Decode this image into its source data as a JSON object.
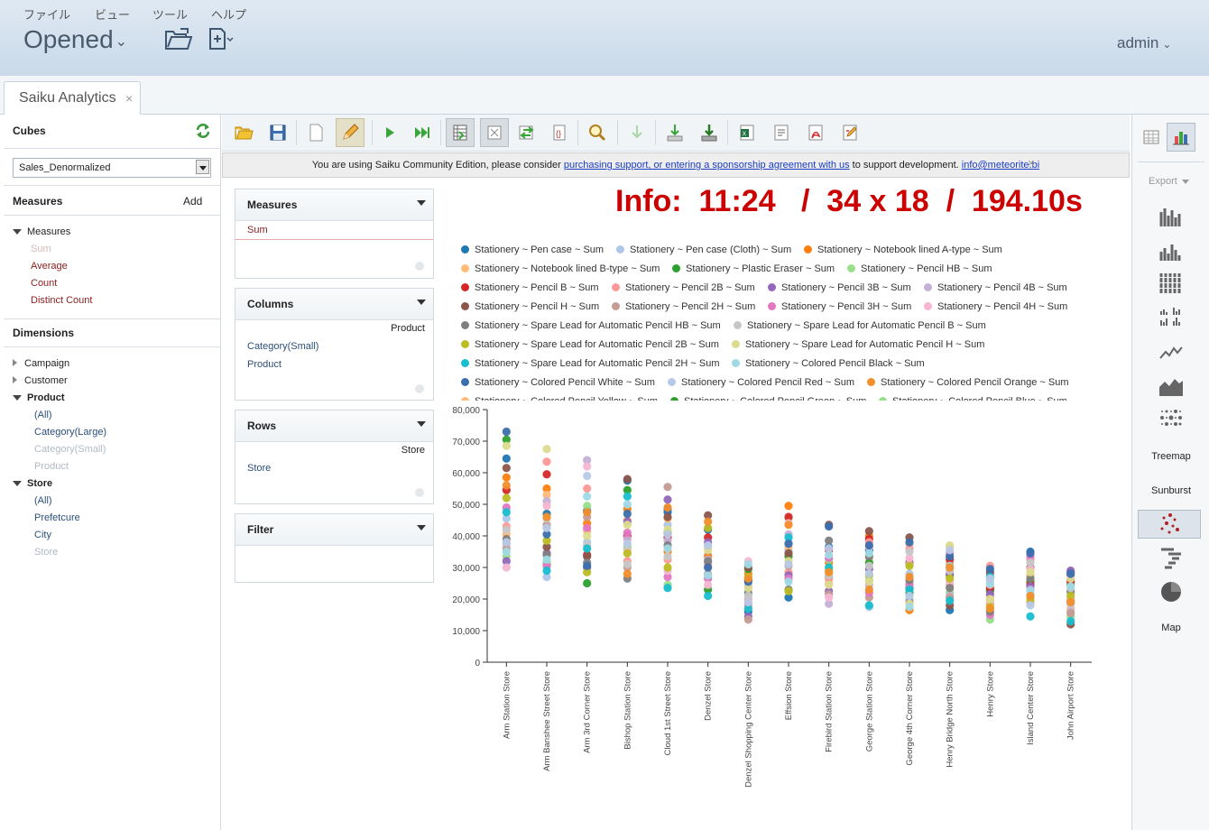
{
  "menu": {
    "file": "ファイル",
    "view": "ビュー",
    "tools": "ツール",
    "help": "ヘルプ"
  },
  "header": {
    "title": "Opened",
    "user": "admin"
  },
  "tab": {
    "label": "Saiku Analytics",
    "close": "×"
  },
  "left": {
    "cubes_label": "Cubes",
    "cube_select": "Sales_Denormalized",
    "measures_label": "Measures",
    "add_label": "Add",
    "measures_root": "Measures",
    "measures": [
      {
        "label": "Sum",
        "disabled": true
      },
      {
        "label": "Average",
        "disabled": false
      },
      {
        "label": "Count",
        "disabled": false
      },
      {
        "label": "Distinct Count",
        "disabled": false
      }
    ],
    "dimensions_label": "Dimensions",
    "dimensions": [
      {
        "label": "Campaign",
        "expanded": false
      },
      {
        "label": "Customer",
        "expanded": false
      },
      {
        "label": "Product",
        "expanded": true,
        "levels": [
          {
            "label": "(All)",
            "disabled": false
          },
          {
            "label": "Category(Large)",
            "disabled": false
          },
          {
            "label": "Category(Small)",
            "disabled": true
          },
          {
            "label": "Product",
            "disabled": true
          }
        ]
      },
      {
        "label": "Store",
        "expanded": true,
        "levels": [
          {
            "label": "(All)",
            "disabled": false
          },
          {
            "label": "Prefetcure",
            "disabled": false
          },
          {
            "label": "City",
            "disabled": false
          },
          {
            "label": "Store",
            "disabled": true
          }
        ]
      }
    ]
  },
  "notice": {
    "before": "You are using Saiku Community Edition, please consider ",
    "link": "purchasing support, or entering a sponsorship agreement with us",
    "after": " to support development. ",
    "email": "info@meteorite.bi",
    "close": "×"
  },
  "workspace": {
    "measures": {
      "label": "Measures",
      "item": "Sum"
    },
    "columns": {
      "label": "Columns",
      "header": "Product",
      "items": [
        "Category(Small)",
        "Product"
      ]
    },
    "rows": {
      "label": "Rows",
      "header": "Store",
      "items": [
        "Store"
      ]
    },
    "filter": {
      "label": "Filter"
    }
  },
  "info": "Info:  11:24   /  34 x 18  /  194.10s",
  "right": {
    "export": "Export",
    "treemap": "Treemap",
    "sunburst": "Sunburst",
    "map": "Map"
  },
  "chart_data": {
    "type": "scatter",
    "ylim": [
      0,
      80000
    ],
    "yticks": [
      "0",
      "10,000",
      "20,000",
      "30,000",
      "40,000",
      "50,000",
      "60,000",
      "70,000",
      "80,000"
    ],
    "categories": [
      "Arm Station Store",
      "Arm Banshee Street Store",
      "Arm 3rd Corner Store",
      "Bishop Station Store",
      "Cloud 1st Street Store",
      "Denzel Store",
      "Denzel Shopping Center Store",
      "Effsion Store",
      "Firebird Station Store",
      "George Station Store",
      "George 4th Corner Store",
      "Henry Bridge North Store",
      "Henry Store",
      "Island Center Store",
      "John Airport Store"
    ],
    "series": [
      {
        "name": "Stationery ~ Pen case ~ Sum",
        "color": "#1f77b4",
        "values": [
          64500,
          47000,
          48000,
          57500,
          47500,
          42000,
          16000,
          20500,
          36500,
          35500,
          23500,
          16500,
          23000,
          35000,
          28500
        ]
      },
      {
        "name": "Stationery ~ Pen case (Cloth) ~ Sum",
        "color": "#aec7e8",
        "values": [
          45500,
          27000,
          38000,
          36000,
          43500,
          34000,
          25000,
          35500,
          22000,
          17500,
          28000,
          30000,
          26000,
          21500,
          22000
        ]
      },
      {
        "name": "Stationery ~ Notebook lined A-type ~ Sum",
        "color": "#ff7f0e",
        "values": [
          58500,
          55000,
          44000,
          48500,
          35000,
          33500,
          28000,
          49500,
          31500,
          40000,
          16500,
          31000,
          18500,
          25500,
          19500
        ]
      },
      {
        "name": "Stationery ~ Notebook lined B-type ~ Sum",
        "color": "#ffbb78",
        "values": [
          40500,
          53000,
          41500,
          45000,
          45500,
          31500,
          17500,
          36500,
          25000,
          33000,
          37500,
          36500,
          20500,
          27500,
          17000
        ]
      },
      {
        "name": "Stationery ~ Plastic Eraser ~ Sum",
        "color": "#2ca02c",
        "values": [
          70500,
          31000,
          25000,
          54500,
          41000,
          23000,
          29500,
          33500,
          27000,
          31500,
          22000,
          27500,
          22500,
          25500,
          24500
        ]
      },
      {
        "name": "Stationery ~ Pencil HB ~ Sum",
        "color": "#98df8a",
        "values": [
          33500,
          31500,
          49500,
          36500,
          24500,
          26500,
          21500,
          45500,
          32500,
          26000,
          20000,
          22000,
          13500,
          23000,
          14500
        ]
      },
      {
        "name": "Stationery ~ Pencil B ~ Sum",
        "color": "#d62728",
        "values": [
          54500,
          59500,
          34000,
          40000,
          39500,
          39500,
          26000,
          46000,
          35500,
          39000,
          31500,
          32500,
          23500,
          24500,
          25500
        ]
      },
      {
        "name": "Stationery ~ Pencil 2B ~ Sum",
        "color": "#ff9896",
        "values": [
          43000,
          63500,
          55000,
          32000,
          32500,
          30500,
          20000,
          28500,
          26500,
          38000,
          36000,
          24500,
          30500,
          32500,
          18500
        ]
      },
      {
        "name": "Stationery ~ Pencil 3B ~ Sum",
        "color": "#9467bd",
        "values": [
          32000,
          34500,
          30000,
          44500,
          51500,
          38000,
          14500,
          27500,
          22500,
          29500,
          19000,
          28000,
          21500,
          24000,
          29000
        ]
      },
      {
        "name": "Stationery ~ Pencil 4B ~ Sum",
        "color": "#c5b0d5",
        "values": [
          37500,
          51000,
          64000,
          39000,
          38500,
          32500,
          24000,
          40500,
          18500,
          24500,
          31000,
          21000,
          28000,
          23000,
          16000
        ]
      },
      {
        "name": "Stationery ~ Pencil H ~ Sum",
        "color": "#8c564b",
        "values": [
          61500,
          36500,
          33500,
          58000,
          46000,
          46500,
          30000,
          34500,
          43500,
          41500,
          39500,
          18000,
          28500,
          30000,
          12000
        ]
      },
      {
        "name": "Stationery ~ Pencil 2H ~ Sum",
        "color": "#c49c94",
        "values": [
          36000,
          43500,
          46000,
          30000,
          55500,
          28000,
          13500,
          30500,
          21500,
          20500,
          25000,
          20500,
          19500,
          19000,
          15500
        ]
      },
      {
        "name": "Stationery ~ Pencil 3H ~ Sum",
        "color": "#e377c2",
        "values": [
          49000,
          30500,
          42500,
          41000,
          27000,
          26500,
          18500,
          26500,
          33000,
          22000,
          24500,
          34500,
          15000,
          33500,
          27500
        ]
      },
      {
        "name": "Stationery ~ Pencil 4H ~ Sum",
        "color": "#f7b6d2",
        "values": [
          30000,
          49500,
          62000,
          35000,
          29000,
          24500,
          32000,
          44000,
          20500,
          36500,
          33000,
          25500,
          19000,
          29500,
          20500
        ]
      },
      {
        "name": "Stationery ~ Spare Lead for Automatic Pencil HB ~ Sum",
        "color": "#7f7f7f",
        "values": [
          39000,
          34000,
          31500,
          26500,
          37000,
          32000,
          22000,
          23000,
          38500,
          33500,
          26000,
          23500,
          16000,
          26500,
          22500
        ]
      },
      {
        "name": "Stationery ~ Spare Lead for Automatic Pencil B ~ Sum",
        "color": "#c7c7c7",
        "values": [
          42000,
          45500,
          37000,
          31000,
          33500,
          36500,
          21000,
          38000,
          27500,
          30500,
          35000,
          29000,
          24500,
          31500,
          23500
        ]
      },
      {
        "name": "Stationery ~ Spare Lead for Automatic Pencil 2B ~ Sum",
        "color": "#bcbd22",
        "values": [
          52000,
          38500,
          28500,
          34500,
          30000,
          42500,
          27000,
          22500,
          29000,
          27500,
          30500,
          26500,
          17500,
          20000,
          21000
        ]
      },
      {
        "name": "Stationery ~ Spare Lead for Automatic Pencil H ~ Sum",
        "color": "#dbdb8d",
        "values": [
          68500,
          67500,
          40000,
          43500,
          42000,
          35500,
          23500,
          32000,
          24500,
          25500,
          18500,
          37000,
          20000,
          28500,
          26500
        ]
      },
      {
        "name": "Stationery ~ Spare Lead for Automatic Pencil 2H ~ Sum",
        "color": "#17becf",
        "values": [
          47500,
          29000,
          36000,
          52500,
          23500,
          21000,
          17000,
          39500,
          30000,
          18000,
          23000,
          19500,
          27000,
          14500,
          13000
        ]
      },
      {
        "name": "Stationery ~ Colored Pencil Black ~ Sum",
        "color": "#9edae5",
        "values": [
          35000,
          32500,
          52500,
          50000,
          36000,
          27500,
          31000,
          25500,
          34000,
          34500,
          17500,
          30500,
          25000,
          22500,
          24000
        ]
      },
      {
        "name": "Stationery ~ Colored Pencil White ~ Sum",
        "color": "#3a6fae",
        "values": [
          73000,
          40500,
          30500,
          47000,
          48500,
          30000,
          25500,
          37500,
          43000,
          37000,
          38000,
          33500,
          29500,
          34500,
          28000
        ]
      },
      {
        "name": "Stationery ~ Colored Pencil Red ~ Sum",
        "color": "#b7c9e6",
        "values": [
          38000,
          42500,
          59000,
          37500,
          40500,
          37000,
          19000,
          31000,
          36000,
          28000,
          21000,
          35500,
          26500,
          18000,
          18500
        ]
      },
      {
        "name": "Stationery ~ Colored Pencil Orange ~ Sum",
        "color": "#f28e2b",
        "values": [
          56000,
          46000,
          47500,
          28000,
          49000,
          44500,
          26500,
          43500,
          28500,
          23000,
          27000,
          30000,
          17000,
          21000,
          19000
        ]
      }
    ],
    "legend_visible": [
      [
        "Stationery ~ Pen case ~ Sum",
        "Stationery ~ Pen case (Cloth) ~ Sum",
        "Stationery ~ Notebook lined A-type ~ Sum"
      ],
      [
        "Stationery ~ Notebook lined B-type ~ Sum",
        "Stationery ~ Plastic Eraser ~ Sum",
        "Stationery ~ Pencil HB ~ Sum"
      ],
      [
        "Stationery ~ Pencil B ~ Sum",
        "Stationery ~ Pencil 2B ~ Sum",
        "Stationery ~ Pencil 3B ~ Sum",
        "Stationery ~ Pencil 4B ~ Sum"
      ],
      [
        "Stationery ~ Pencil H ~ Sum",
        "Stationery ~ Pencil 2H ~ Sum",
        "Stationery ~ Pencil 3H ~ Sum",
        "Stationery ~ Pencil 4H ~ Sum"
      ],
      [
        "Stationery ~ Spare Lead for Automatic Pencil HB ~ Sum",
        "Stationery ~ Spare Lead for Automatic Pencil B ~ Sum"
      ],
      [
        "Stationery ~ Spare Lead for Automatic Pencil 2B ~ Sum",
        "Stationery ~ Spare Lead for Automatic Pencil H ~ Sum"
      ],
      [
        "Stationery ~ Spare Lead for Automatic Pencil 2H ~ Sum",
        "Stationery ~ Colored Pencil Black ~ Sum"
      ],
      [
        "Stationery ~ Colored Pencil White ~ Sum",
        "Stationery ~ Colored Pencil Red ~ Sum",
        "Stationery ~ Colored Pencil Orange ~ Sum"
      ],
      [
        "Stationery ~ Colored Pencil Yellow ~ Sum",
        "Stationery ~ Colored Pencil Green ~ Sum",
        "Stationery ~ Colored Pencil Blue ~ Sum"
      ]
    ],
    "legend_colors_hidden_row": [
      "#ffbb78",
      "#2ca02c",
      "#98df8a"
    ]
  }
}
